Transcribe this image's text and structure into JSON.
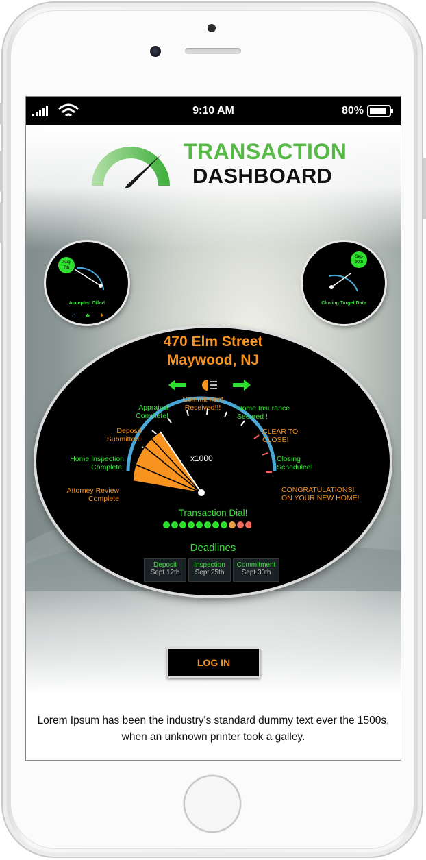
{
  "status_bar": {
    "time": "9:10 AM",
    "battery": "80%"
  },
  "logo": {
    "line1": "TRANSACTION",
    "line2": "DASHBOARD"
  },
  "left_mini_dial": {
    "date_month": "Aug",
    "date_day": "7th",
    "label": "Accepted Offer!"
  },
  "right_mini_dial": {
    "date_month": "Sep",
    "date_day": "30th",
    "label": "Closing Target Date"
  },
  "property": {
    "street": "470 Elm Street",
    "city": "Maywood, NJ"
  },
  "gauge": {
    "multiplier": "x1000",
    "labels": {
      "attorney_review": "Attorney Review Complete",
      "home_inspection": "Home Inspection Complete!",
      "deposit": "Deposit Submitted!",
      "appraisal": "Appraisal Complete!",
      "commitment": "Commitment Received!!!",
      "home_insurance": "Home Insurance Secured !",
      "clear_to_close": "CLEAR TO CLOSE!",
      "closing": "Closing Scheduled!",
      "congrats": "CONGRATULATIONS! ON YOUR NEW HOME!"
    },
    "dial_title": "Transaction Dial!",
    "progress_dots": [
      "green",
      "green",
      "green",
      "green",
      "green",
      "green",
      "green",
      "green",
      "orange",
      "red",
      "red"
    ]
  },
  "deadlines": {
    "title": "Deadlines",
    "items": [
      {
        "label": "Deposit",
        "date": "Sept 12th"
      },
      {
        "label": "Inspection",
        "date": "Sept 25th"
      },
      {
        "label": "Commitment",
        "date": "Sept 30th"
      }
    ]
  },
  "login_button": "LOG IN",
  "body_text": "Lorem Ipsum has been the industry's standard dummy text ever the 1500s, when an unknown printer took a galley.",
  "colors": {
    "accent_green": "#3be23b",
    "accent_orange": "#f7931e",
    "logo_green": "#56b946",
    "gauge_blue": "#4aa8d8"
  }
}
